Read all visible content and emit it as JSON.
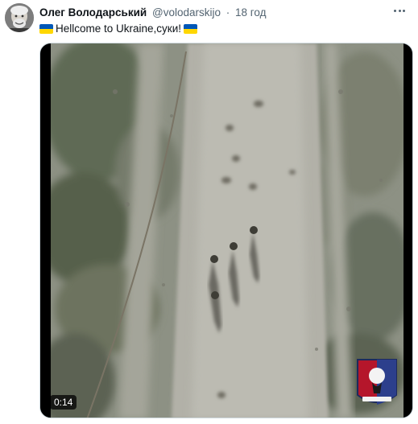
{
  "author": {
    "name": "Олег Володарський",
    "handle": "@volodarskijo",
    "separator": "·",
    "time": "18 год"
  },
  "tweet": {
    "text": "Hellcome to Ukraine,суки!",
    "flag_colors": {
      "blue": "#0057b7",
      "yellow": "#ffd700"
    }
  },
  "media": {
    "type": "video",
    "duration": "0:14"
  },
  "icons": {
    "more": "more-options-icon",
    "avatar": "avatar-photo",
    "emblem": "unit-emblem"
  }
}
